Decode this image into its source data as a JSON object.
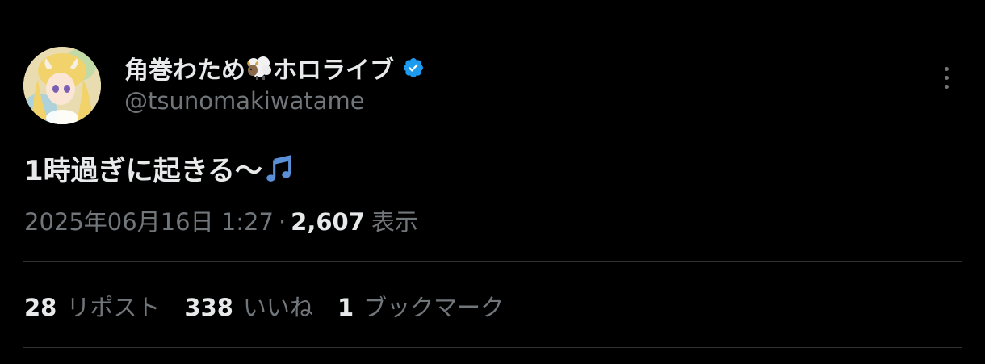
{
  "author": {
    "name_part1": "角巻わため",
    "name_part2": "ホロライブ",
    "handle": "@tsunomakiwatame",
    "verified_color": "#1d9bf0"
  },
  "tweet": {
    "text": "1時過ぎに起きる〜",
    "timestamp": "2025年06月16日 1:27",
    "separator": "·",
    "views_count": "2,607",
    "views_label": "表示"
  },
  "stats": {
    "reposts_count": "28",
    "reposts_label": "リポスト",
    "likes_count": "338",
    "likes_label": "いいね",
    "bookmarks_count": "1",
    "bookmarks_label": "ブックマーク"
  },
  "icons": {
    "avatar": "avatar",
    "sheep": "sheep-icon",
    "verified": "verified-badge-icon",
    "more": "more-options-icon",
    "music": "musical-note-icon"
  }
}
